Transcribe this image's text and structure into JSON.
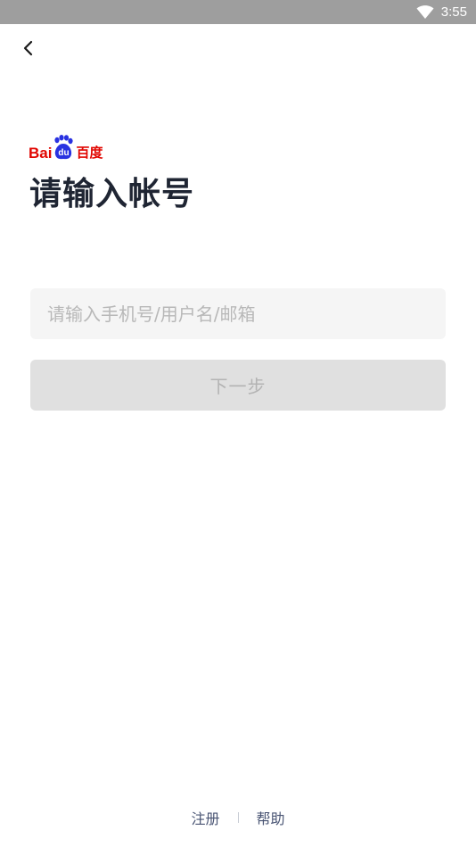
{
  "status_bar": {
    "time": "3:55",
    "wifi_icon": "wifi-icon"
  },
  "header": {
    "back_icon": "chevron-left-icon"
  },
  "logo": {
    "text_latin": "Bai",
    "text_du": "du",
    "text_cn": "百度",
    "brand_color": "#e10601"
  },
  "main": {
    "title": "请输入帐号",
    "account_input": {
      "value": "",
      "placeholder": "请输入手机号/用户名/邮箱"
    },
    "next_button_label": "下一步"
  },
  "footer": {
    "register_label": "注册",
    "help_label": "帮助"
  }
}
